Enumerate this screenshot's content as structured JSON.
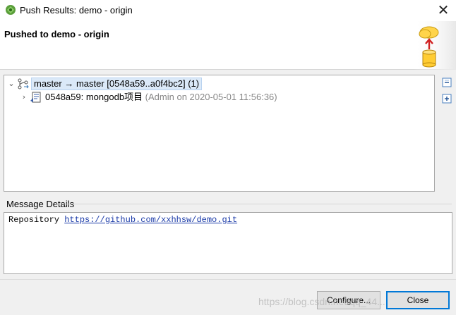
{
  "window": {
    "title": "Push Results: demo - origin",
    "close_glyph": "✕"
  },
  "header": {
    "heading": "Pushed to demo - origin"
  },
  "tree": {
    "root": {
      "expand_glyph": "⌄",
      "label": "master → master [0548a59..a0f4bc2] (1)",
      "icon": "branch-icon"
    },
    "child": {
      "expand_glyph": "›",
      "label": "0548a59: mongodb项目",
      "meta": "(Admin on 2020-05-01 11:56:36)",
      "icon": "commit-icon"
    }
  },
  "message_details": {
    "label": "Message Details",
    "repo_label": "Repository",
    "repo_url": "https://github.com/xxhhsw/demo.git"
  },
  "buttons": {
    "configure": "Configure...",
    "close": "Close"
  },
  "watermark": "https://blog.csdn.net/qq_44..."
}
